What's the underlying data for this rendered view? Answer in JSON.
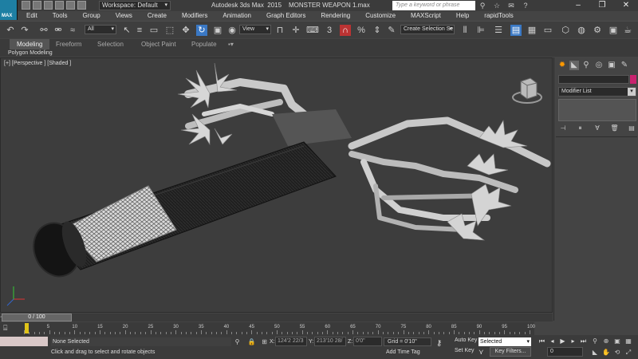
{
  "app": {
    "logo_text": "MAX",
    "title": "Autodesk 3ds Max  2015",
    "file_name": "MONSTER WEAPON 1.max",
    "workspace": "Workspace: Default",
    "search_placeholder": "Type a keyword or phrase"
  },
  "menu": [
    "Edit",
    "Tools",
    "Group",
    "Views",
    "Create",
    "Modifiers",
    "Animation",
    "Graph Editors",
    "Rendering",
    "Customize",
    "MAXScript",
    "Help",
    "rapidTools"
  ],
  "toolbar": {
    "selection_filter": "All",
    "ref_coord": "View",
    "named_selection": "Create Selection Se"
  },
  "ribbon": {
    "tabs": [
      "Modeling",
      "Freeform",
      "Selection",
      "Object Paint",
      "Populate"
    ],
    "active_tab": "Modeling",
    "panel_label": "Polygon Modeling"
  },
  "viewport": {
    "label": "[+] [Perspective ] [Shaded ]"
  },
  "command_panel": {
    "modifier_list": "Modifier List",
    "object_color": "#c9226e"
  },
  "timeline": {
    "slider": "0 / 100",
    "ticks": [
      "5",
      "10",
      "15",
      "20",
      "25",
      "30",
      "35",
      "40",
      "45",
      "50",
      "55",
      "60",
      "65",
      "70",
      "75",
      "80",
      "85",
      "90",
      "95",
      "100"
    ]
  },
  "status": {
    "selection": "None Selected",
    "prompt": "Click and drag to select and rotate objects",
    "x_label": "X:",
    "x_value": "124'2 22/3",
    "y_label": "Y:",
    "y_value": "213'10 28/",
    "z_label": "Z:",
    "z_value": "0'0\"",
    "grid": "Grid = 0'10\"",
    "add_time_tag": "Add Time Tag",
    "auto_key": "Auto Key",
    "set_key": "Set Key",
    "selected_dd": "Selected",
    "key_filters": "Key Filters...",
    "frame": "0"
  }
}
